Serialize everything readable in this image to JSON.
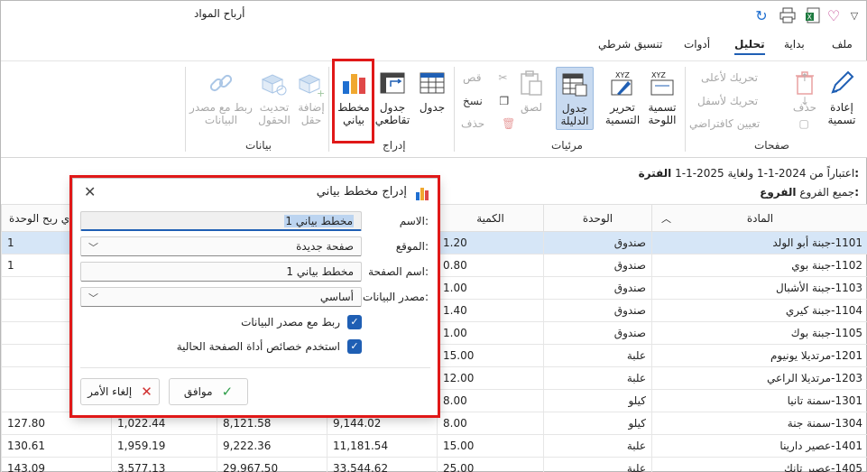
{
  "window": {
    "title": "أرباح المواد",
    "icons": [
      "refresh-icon",
      "print-icon",
      "excel-icon",
      "heart-icon",
      "chevron-down-icon"
    ]
  },
  "menu": {
    "tabs": [
      "ملف",
      "بداية",
      "تحليل",
      "أدوات",
      "تنسيق شرطي"
    ],
    "active": "تحليل"
  },
  "ribbon": {
    "pages_group": {
      "label": "صفحات",
      "rename": "إعادة\nتسمية",
      "delete": "حذف",
      "move_up": "تحريك لأعلى",
      "move_down": "تحريك لأسفل",
      "set_default": "تعيين كافتراضي"
    },
    "visibles_group": {
      "label": "مرئيات",
      "panel_name": "تسمية\nاللوحة",
      "edit_name": "تحرير\nالتسمية",
      "guide_table": "جدول\nالدليلة",
      "paste": "لصق",
      "cut": "قص",
      "copy": "نسخ",
      "delete": "حذف"
    },
    "insert_group": {
      "label": "إدراج",
      "table": "جدول",
      "pivot_table": "جدول\nتقاطعي",
      "chart": "مخطط\nبياني"
    },
    "data_group": {
      "label": "بيانات",
      "add_field": "إضافة\nحقل",
      "refresh_fields": "تحديث\nالحقول",
      "link_source": "ربط مع مصدر\nالبيانات"
    }
  },
  "filters": {
    "period_label": "الفترة:",
    "period_value": "اعتباراً من 2024-1-1 ولغاية 2025-1-1",
    "branches_label": "الفروع:",
    "branches_value": "جميع الفروع"
  },
  "table": {
    "headers": [
      "المادة",
      "الوحدة",
      "الكمية",
      "",
      "",
      "",
      "ي ربح الوحدة"
    ],
    "rows": [
      [
        "1101-جبنة أبو الولد",
        "صندوق",
        "1.20",
        "",
        "",
        "",
        "1"
      ],
      [
        "1102-جبنة بوي",
        "صندوق",
        "0.80",
        "",
        "",
        "",
        "1"
      ],
      [
        "1103-جبنة الأشبال",
        "صندوق",
        "1.00",
        "",
        "",
        "",
        ""
      ],
      [
        "1104-جبنة كيري",
        "صندوق",
        "1.40",
        "",
        "",
        "",
        ""
      ],
      [
        "1105-جبنة بوك",
        "صندوق",
        "1.00",
        "",
        "",
        "",
        ""
      ],
      [
        "1201-مرتديلا يونيوم",
        "علبة",
        "15.00",
        "",
        "",
        "",
        ""
      ],
      [
        "1203-مرتديلا الراعي",
        "علبة",
        "12.00",
        "",
        "",
        "",
        ""
      ],
      [
        "1301-سمنة تانيا",
        "كيلو",
        "8.00",
        "",
        "",
        "",
        ""
      ],
      [
        "1304-سمنة جنة",
        "كيلو",
        "8.00",
        "9,144.02",
        "8,121.58",
        "1,022.44",
        "127.80"
      ],
      [
        "1401-عصير دارينا",
        "علبة",
        "15.00",
        "11,181.54",
        "9,222.36",
        "1,959.19",
        "130.61"
      ],
      [
        "1405-عصير تانك",
        "علبة",
        "25.00",
        "33,544.62",
        "29,967.50",
        "3,577.13",
        "143.09"
      ]
    ]
  },
  "dialog": {
    "title": "إدراج مخطط بياني",
    "name_label": "الاسم:",
    "name_value": "مخطط بياني 1",
    "location_label": "الموقع:",
    "location_value": "صفحة جديدة",
    "page_name_label": "اسم الصفحة:",
    "page_name_value": "مخطط بياني 1",
    "data_source_label": "مصدر البيانات:",
    "data_source_value": "أساسي",
    "link_checkbox": "ربط مع مصدر البيانات",
    "use_props_checkbox": "استخدم خصائص أداة الصفحة الحالية",
    "ok_button": "موافق",
    "cancel_button": "إلغاء الأمر"
  },
  "colors": {
    "accent": "#1f5fb4",
    "highlight": "#e01818",
    "selected_row": "#d6e6f7"
  }
}
